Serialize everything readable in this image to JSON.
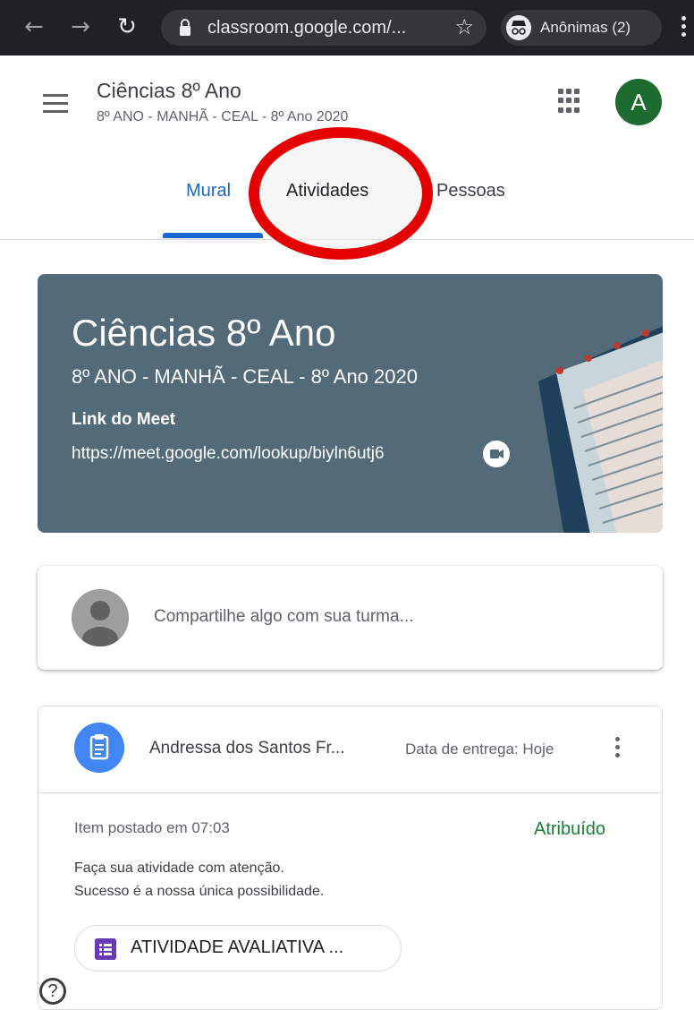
{
  "browser": {
    "url": "classroom.google.com/...",
    "incognito_label": "Anônimas (2)"
  },
  "header": {
    "course_title": "Ciências 8º Ano",
    "course_subtitle": "8º ANO - MANHÃ - CEAL - 8º Ano 2020",
    "avatar_letter": "A",
    "tabs": [
      {
        "label": "Mural",
        "active": true
      },
      {
        "label": "Atividades",
        "active": false
      },
      {
        "label": "Pessoas",
        "active": false
      }
    ]
  },
  "banner": {
    "title": "Ciências 8º Ano",
    "subtitle": "8º ANO - MANHÃ - CEAL - 8º Ano 2020",
    "link_label": "Link do Meet",
    "link": "https://meet.google.com/lookup/biyln6utj6"
  },
  "compose": {
    "placeholder": "Compartilhe algo com sua turma..."
  },
  "post": {
    "author": "Andressa dos Santos Fr...",
    "due": "Data de entrega: Hoje",
    "posted": "Item postado em 07:03",
    "status": "Atribuído",
    "body_line1": "Faça sua atividade com atenção.",
    "body_line2": "Sucesso é a nossa única possibilidade.",
    "attachment": "ATIVIDADE AVALIATIVA ..."
  },
  "colors": {
    "accent": "#1967d2",
    "banner": "#536b78",
    "status_green": "#188038",
    "highlight_circle": "#e40000"
  }
}
